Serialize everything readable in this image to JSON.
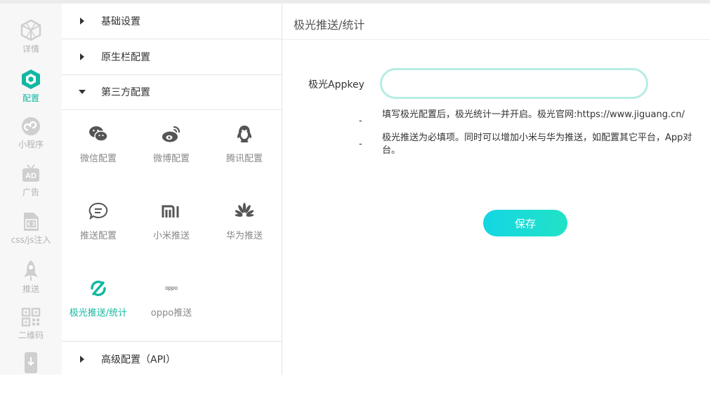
{
  "rail": {
    "items": [
      {
        "label": "详情",
        "icon": "cube-outline-icon",
        "active": false
      },
      {
        "label": "配置",
        "icon": "cube-filled-icon",
        "active": true
      },
      {
        "label": "小程序",
        "icon": "miniprogram-icon",
        "active": false
      },
      {
        "label": "广告",
        "icon": "ad-tv-icon",
        "active": false
      },
      {
        "label": "css/js注入",
        "icon": "code-file-icon",
        "active": false
      },
      {
        "label": "推送",
        "icon": "rocket-icon",
        "active": false
      },
      {
        "label": "二维码",
        "icon": "qrcode-icon",
        "active": false
      },
      {
        "label": "",
        "icon": "phone-download-icon",
        "active": false
      }
    ],
    "accent": "#12b8a2",
    "inactive_color": "#c4c4c4"
  },
  "panel": {
    "sections": [
      {
        "label": "基础设置",
        "expanded": false
      },
      {
        "label": "原生栏配置",
        "expanded": false
      },
      {
        "label": "第三方配置",
        "expanded": true
      },
      {
        "label": "高级配置（API）",
        "expanded": false
      }
    ],
    "tiles": [
      {
        "label": "微信配置",
        "icon": "wechat-icon",
        "active": false
      },
      {
        "label": "微博配置",
        "icon": "weibo-icon",
        "active": false
      },
      {
        "label": "腾讯配置",
        "icon": "qq-penguin-icon",
        "active": false
      },
      {
        "label": "推送配置",
        "icon": "chat-bubble-icon",
        "active": false
      },
      {
        "label": "小米推送",
        "icon": "xiaomi-logo-icon",
        "active": false
      },
      {
        "label": "华为推送",
        "icon": "huawei-logo-icon",
        "active": false
      },
      {
        "label": "极光推送/统计",
        "icon": "jpush-logo-icon",
        "active": true
      },
      {
        "label": "oppo推送",
        "icon": "oppo-logo-icon",
        "active": false
      }
    ],
    "oppo_logo_text": "oppo"
  },
  "content": {
    "title": "极光推送/统计",
    "appkey_label": "极光Appkey",
    "appkey_value": "",
    "hint1": "填写极光配置后，极光统计一并开启。极光官网:https://www.jiguang.cn/",
    "hint2_line1": "极光推送为必填项。同时可以增加小米与华为推送，如配置其它平台，App对",
    "hint2_line2": "台。",
    "dash": "-",
    "save_label": "保存"
  }
}
